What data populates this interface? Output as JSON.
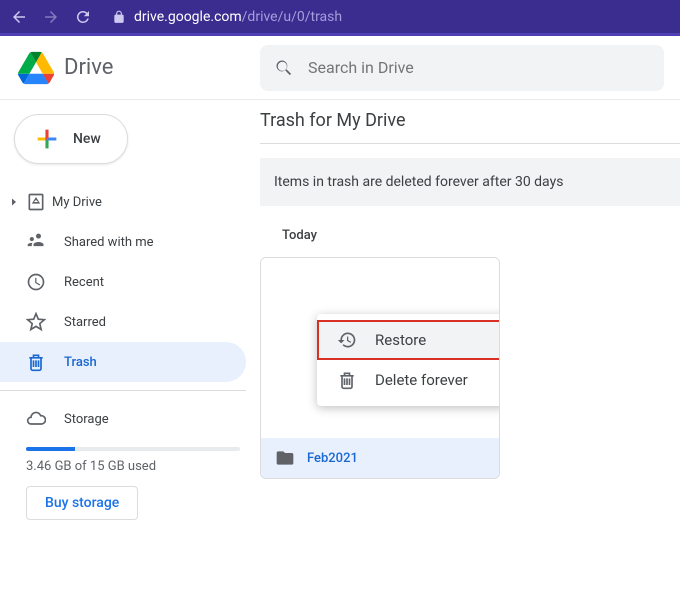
{
  "browser": {
    "url_domain": "drive.google.com",
    "url_path": "/drive/u/0/trash"
  },
  "brand": "Drive",
  "search": {
    "placeholder": "Search in Drive"
  },
  "new_button": "New",
  "sidebar": {
    "items": [
      {
        "label": "My Drive"
      },
      {
        "label": "Shared with me"
      },
      {
        "label": "Recent"
      },
      {
        "label": "Starred"
      },
      {
        "label": "Trash"
      }
    ],
    "storage_label": "Storage",
    "storage_used": "3.46 GB of 15 GB used",
    "buy_label": "Buy storage"
  },
  "main": {
    "title": "Trash for My Drive",
    "banner": "Items in trash are deleted forever after 30 days",
    "section": "Today",
    "file_name": "Feb2021"
  },
  "context_menu": {
    "restore": "Restore",
    "delete": "Delete forever"
  }
}
